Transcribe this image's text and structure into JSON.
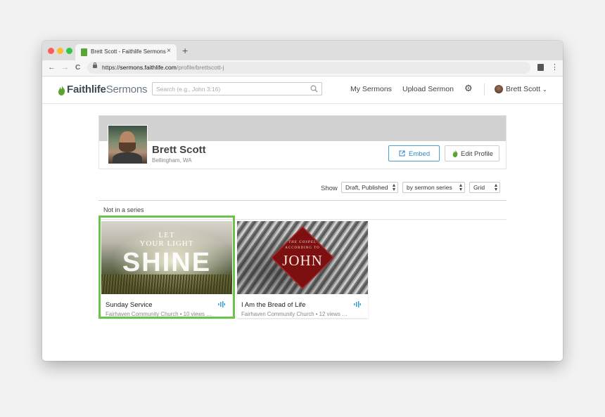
{
  "browser": {
    "tab_title": "Brett Scott - Faithlife Sermons",
    "tab_close": "×",
    "new_tab": "+",
    "url_scheme": "https://",
    "url_host": "sermons.faithlife.com",
    "url_path": "/profile/brettscott-j",
    "nav": {
      "back": "←",
      "forward": "→",
      "reload": "C"
    },
    "menu": "⋮",
    "traffic_colors": [
      "#fc5f57",
      "#fdbc2e",
      "#33c748"
    ]
  },
  "header": {
    "logo_bold": "Faithlife",
    "logo_light": "Sermons",
    "search_placeholder": "Search (e.g., John 3:16)",
    "links": {
      "my_sermons": "My Sermons",
      "upload_sermon": "Upload Sermon"
    },
    "user_name": "Brett Scott",
    "user_caret": "⌄",
    "brand_color": "#5aa332"
  },
  "profile": {
    "name": "Brett Scott",
    "location": "Bellingham, WA",
    "embed_label": "Embed",
    "edit_label": "Edit Profile"
  },
  "filters": {
    "show_label": "Show",
    "status": "Draft, Published",
    "grouping": "by sermon series",
    "view": "Grid"
  },
  "series_heading": "Not in a series",
  "sermons": [
    {
      "title": "Sunday Service",
      "meta": "Fairhaven Community Church • 10 views …",
      "art": {
        "line1": "LET",
        "line2": "YOUR LIGHT",
        "line3": "SHINE"
      }
    },
    {
      "title": "I Am the Bread of Life",
      "meta": "Fairhaven Community Church • 12 views …",
      "art": {
        "line1": "THE GOSPEL",
        "line2": "ACCORDING TO",
        "line3": "JOHN"
      }
    }
  ]
}
